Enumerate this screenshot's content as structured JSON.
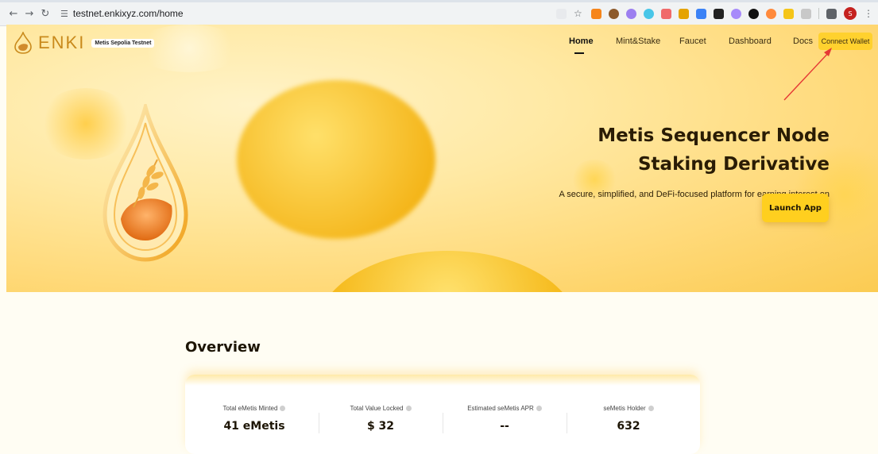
{
  "browser": {
    "url": "testnet.enkixyz.com/home",
    "profile_initial": "S"
  },
  "header": {
    "brand": "ENKI",
    "network_badge": "Metis Sepolia Testnet",
    "nav": [
      {
        "label": "Home",
        "active": true
      },
      {
        "label": "Mint&Stake",
        "active": false
      },
      {
        "label": "Faucet",
        "active": false
      },
      {
        "label": "Dashboard",
        "active": false
      },
      {
        "label": "Docs",
        "active": false
      }
    ],
    "connect_label": "Connect Wallet"
  },
  "hero": {
    "title_line1": "Metis Sequencer Node",
    "title_line2": "Staking Derivative",
    "subtitle": "A secure, simplified, and DeFi-focused platform for earning interest on Metis.",
    "cta_label": "Launch App"
  },
  "overview": {
    "title": "Overview",
    "stats": [
      {
        "label": "Total eMetis Minted",
        "value": "41 eMetis"
      },
      {
        "label": "Total Value Locked",
        "value": "$ 32"
      },
      {
        "label": "Estimated seMetis APR",
        "value": "--"
      },
      {
        "label": "seMetis Holder",
        "value": "632"
      }
    ]
  },
  "colors": {
    "accent": "#ffcf1f",
    "brand": "#c98a1c",
    "text_dark": "#1d1505"
  }
}
